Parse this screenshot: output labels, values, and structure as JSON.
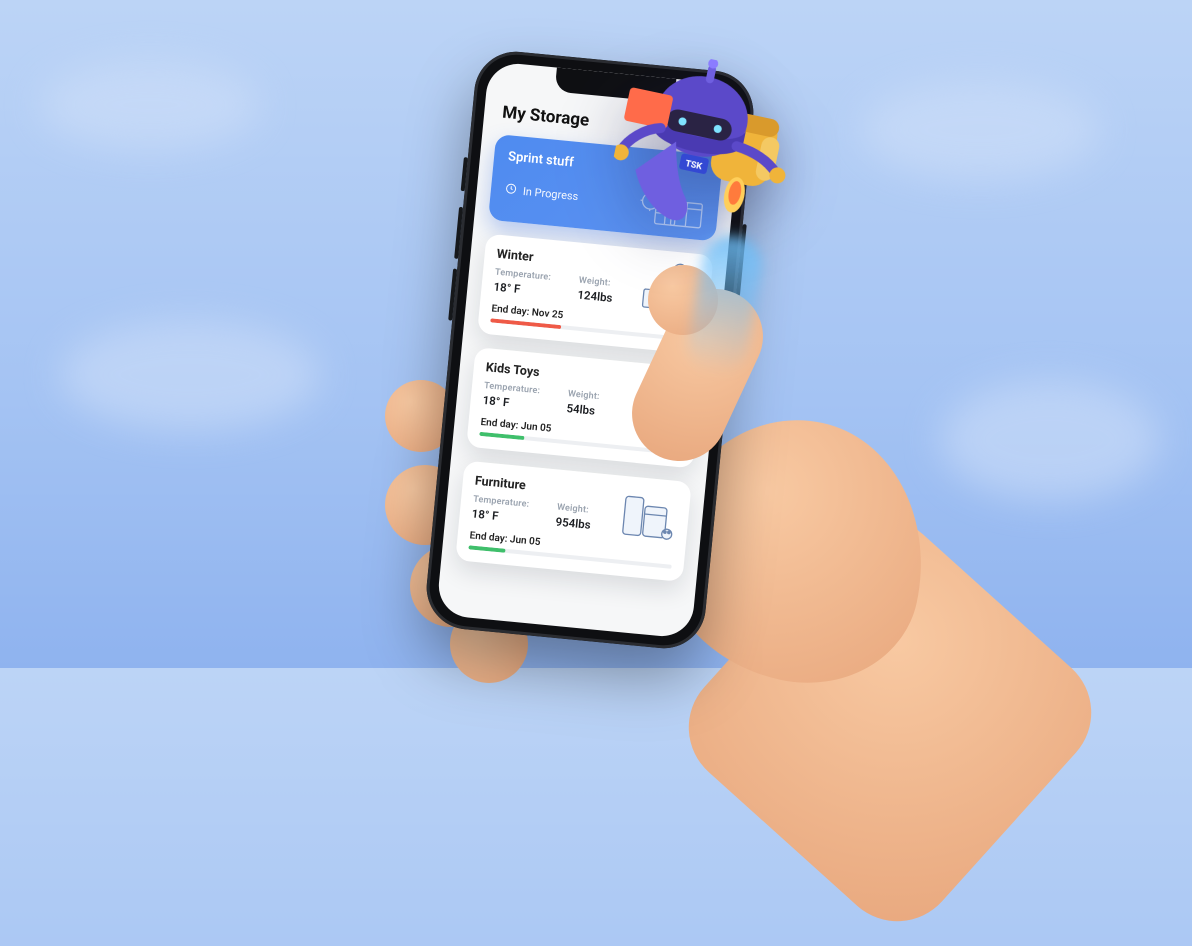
{
  "page": {
    "title": "My Storage"
  },
  "hero": {
    "title": "Sprint stuff",
    "status": "In Progress"
  },
  "labels": {
    "temperature": "Temperature:",
    "weight": "Weight:",
    "end_day_prefix": "End day: "
  },
  "colors": {
    "hero_gradient_start": "#4f8bf0",
    "hero_gradient_end": "#5c93f2",
    "bar_red": "#ef5a47",
    "bar_green": "#3fbf6b"
  },
  "cards": [
    {
      "title": "Winter",
      "temperature": "18° F",
      "weight": "124lbs",
      "end_day": "Nov 25",
      "progress_pct": 35,
      "progress_color": "bar_red"
    },
    {
      "title": "Kids Toys",
      "temperature": "18° F",
      "weight": "54lbs",
      "end_day": "Jun 05",
      "progress_pct": 22,
      "progress_color": "bar_green"
    },
    {
      "title": "Furniture",
      "temperature": "18° F",
      "weight": "954lbs",
      "end_day": "Jun 05",
      "progress_pct": 18,
      "progress_color": "bar_green"
    }
  ],
  "mascot": {
    "badge": "TSK"
  }
}
